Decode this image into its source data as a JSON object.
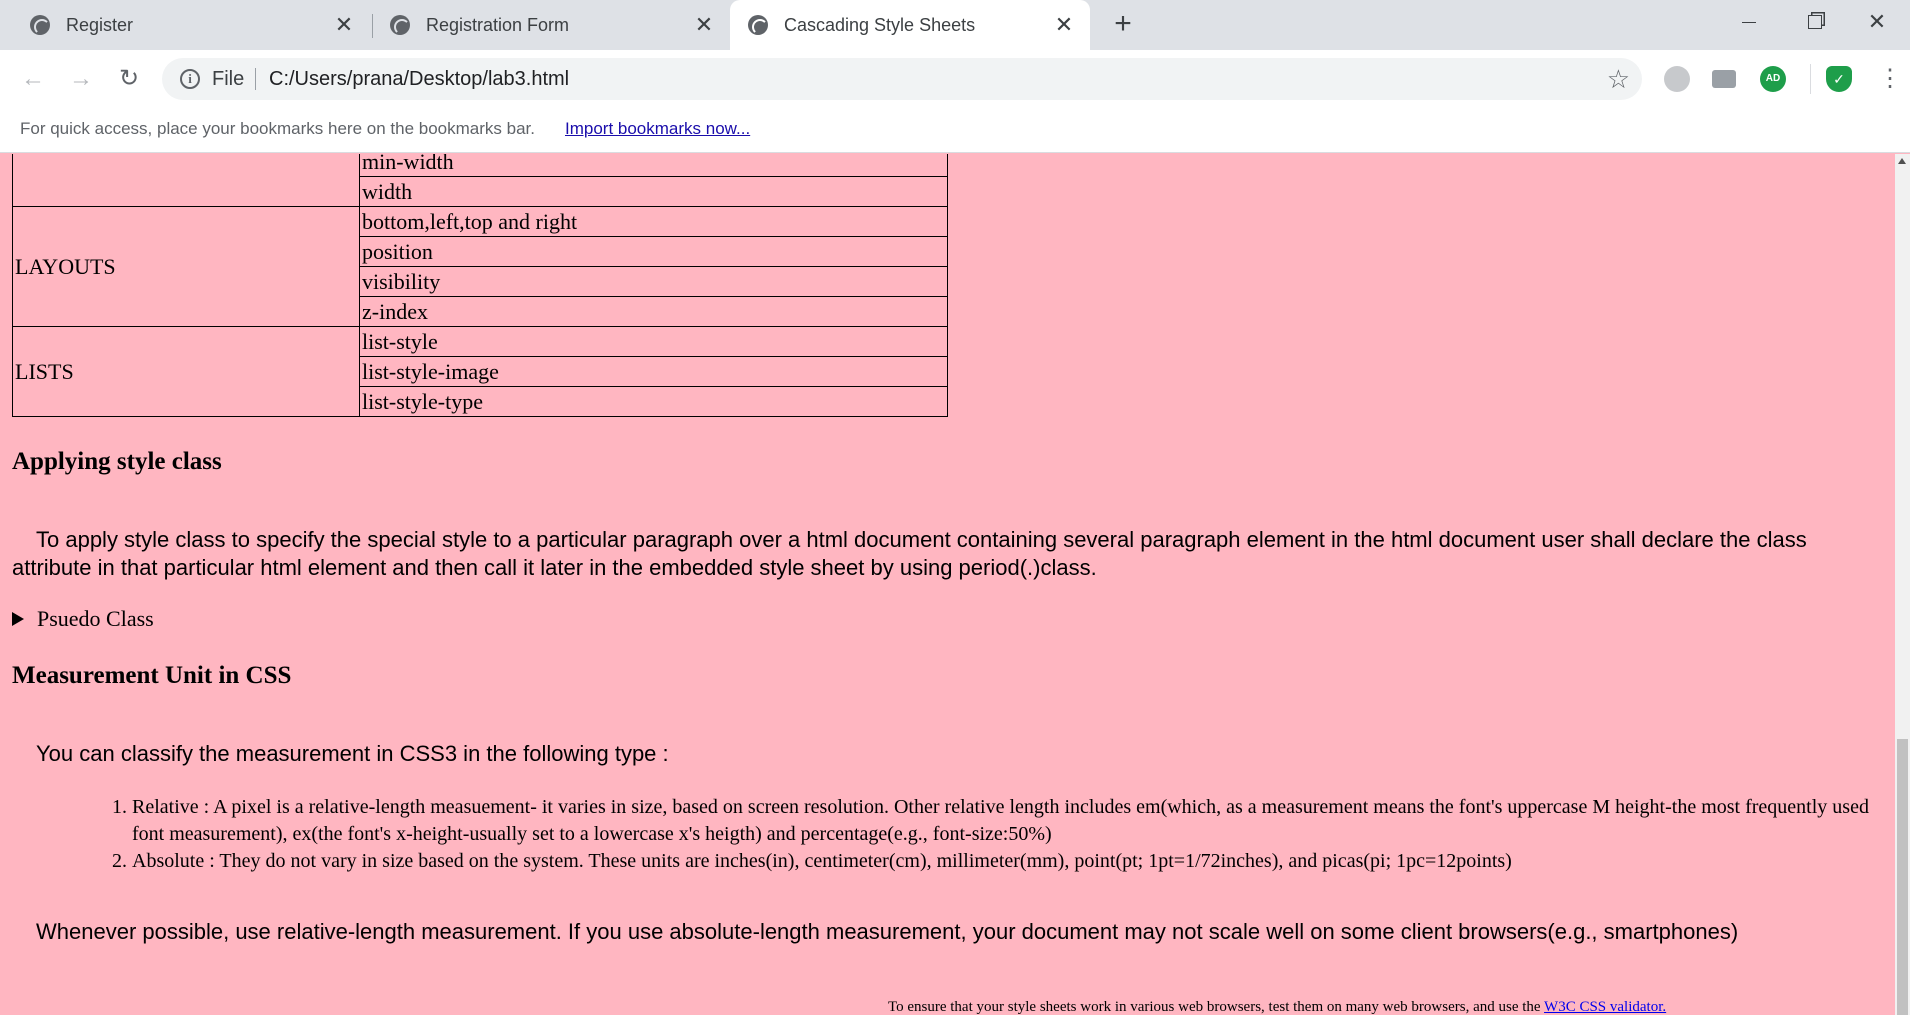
{
  "browser": {
    "tabs": [
      {
        "title": "Register",
        "active": false,
        "icon": "globe-icon"
      },
      {
        "title": "Registration Form",
        "active": false,
        "icon": "globe-icon"
      },
      {
        "title": "Cascading Style Sheets",
        "active": true,
        "icon": "globe-icon"
      }
    ],
    "new_tab_icon": "plus-icon",
    "address": {
      "scheme_label": "File",
      "url": "C:/Users/prana/Desktop/lab3.html"
    },
    "extension_ad_label": "AD",
    "bookmarks_bar": {
      "message": "For quick access, place your bookmarks here on the bookmarks bar.",
      "link": "Import bookmarks now..."
    }
  },
  "page": {
    "table": {
      "rows": [
        {
          "category": "",
          "properties": [
            "min-width",
            "width"
          ]
        },
        {
          "category": "LAYOUTS",
          "properties": [
            "bottom,left,top and right",
            "position",
            "visibility",
            "z-index"
          ]
        },
        {
          "category": "LISTS",
          "properties": [
            "list-style",
            "list-style-image",
            "list-style-type"
          ]
        }
      ]
    },
    "style_class": {
      "heading": "Applying style class",
      "paragraph": "To apply style class to specify the special style to a particular paragraph over a html document containing several paragraph element in the html document user shall declare the class attribute in that particular html element and then call it later in the embedded style sheet by using period(.)class."
    },
    "pseudo_class_summary": "Psuedo Class",
    "measurement": {
      "heading": "Measurement Unit in CSS",
      "intro": "You can classify the measurement in CSS3 in the following type :",
      "items": [
        "Relative : A pixel is a relative-length measuement- it varies in size, based on screen resolution. Other relative length includes em(which, as a measurement means the font's uppercase M height-the most frequently used font measurement), ex(the font's x-height-usually set to a lowercase x's heigth) and percentage(e.g., font-size:50%)",
        "Absolute : They do not vary in size based on the system. These units are inches(in), centimeter(cm), millimeter(mm), point(pt; 1pt=1/72inches), and picas(pi; 1pc=12points)"
      ],
      "advice": "Whenever possible, use relative-length measurement. If you use absolute-length measurement, your document may not scale well on some client browsers(e.g., smartphones)"
    },
    "footer": {
      "text": "To ensure that your style sheets work in various web browsers, test them on many web browsers, and use the ",
      "link": "W3C CSS validator."
    }
  }
}
